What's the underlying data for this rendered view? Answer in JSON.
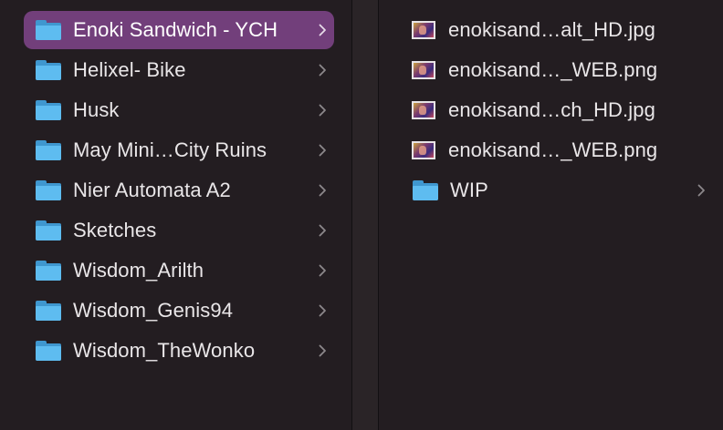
{
  "colors": {
    "background": "#231d21",
    "selection": "#723f7b",
    "text": "#e9e6e8",
    "folder": "#5ebcf0",
    "chevron": "#8c888b"
  },
  "left_column": {
    "items": [
      {
        "label": "Enoki Sandwich - YCH",
        "icon": "folder-icon",
        "selected": true
      },
      {
        "label": "Helixel- Bike",
        "icon": "folder-icon",
        "selected": false
      },
      {
        "label": "Husk",
        "icon": "folder-icon",
        "selected": false
      },
      {
        "label": "May Mini…City Ruins",
        "icon": "folder-icon",
        "selected": false
      },
      {
        "label": "Nier Automata A2",
        "icon": "folder-icon",
        "selected": false
      },
      {
        "label": "Sketches",
        "icon": "folder-icon",
        "selected": false
      },
      {
        "label": "Wisdom_Arilth",
        "icon": "folder-icon",
        "selected": false
      },
      {
        "label": "Wisdom_Genis94",
        "icon": "folder-icon",
        "selected": false
      },
      {
        "label": "Wisdom_TheWonko",
        "icon": "folder-icon",
        "selected": false
      }
    ]
  },
  "right_column": {
    "items": [
      {
        "label": "enokisand…alt_HD.jpg",
        "icon": "image-thumbnail-icon",
        "is_folder": false
      },
      {
        "label": "enokisand…_WEB.png",
        "icon": "image-thumbnail-icon",
        "is_folder": false
      },
      {
        "label": "enokisand…ch_HD.jpg",
        "icon": "image-thumbnail-icon",
        "is_folder": false
      },
      {
        "label": "enokisand…_WEB.png",
        "icon": "image-thumbnail-icon",
        "is_folder": false
      },
      {
        "label": "WIP",
        "icon": "folder-icon",
        "is_folder": true
      }
    ]
  }
}
